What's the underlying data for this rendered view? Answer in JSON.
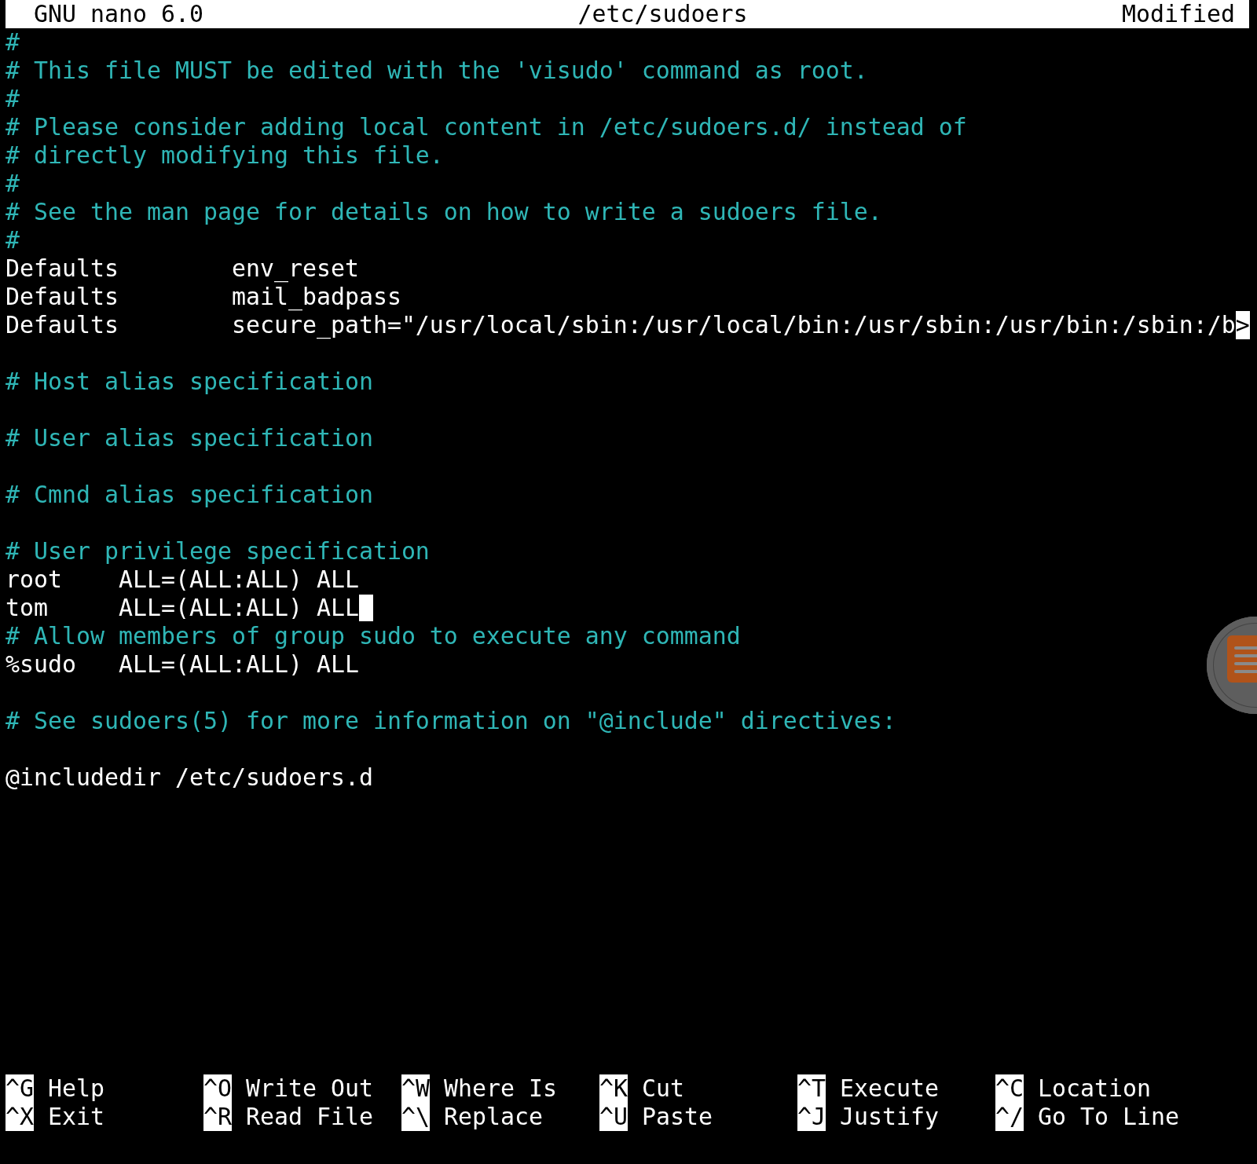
{
  "title_bar": {
    "version": "GNU nano 6.0",
    "filename": "/etc/sudoers",
    "status": "Modified"
  },
  "lines": [
    {
      "kind": "comment",
      "text": "#"
    },
    {
      "kind": "comment",
      "text": "# This file MUST be edited with the 'visudo' command as root."
    },
    {
      "kind": "comment",
      "text": "#"
    },
    {
      "kind": "comment",
      "text": "# Please consider adding local content in /etc/sudoers.d/ instead of"
    },
    {
      "kind": "comment",
      "text": "# directly modifying this file."
    },
    {
      "kind": "comment",
      "text": "#"
    },
    {
      "kind": "comment",
      "text": "# See the man page for details on how to write a sudoers file."
    },
    {
      "kind": "comment",
      "text": "#"
    },
    {
      "kind": "code",
      "text": "Defaults        env_reset"
    },
    {
      "kind": "code",
      "text": "Defaults        mail_badpass"
    },
    {
      "kind": "code",
      "text": "Defaults        secure_path=\"/usr/local/sbin:/usr/local/bin:/usr/sbin:/usr/bin:/sbin:/b",
      "overflow_marker": ">"
    },
    {
      "kind": "blank"
    },
    {
      "kind": "comment",
      "text": "# Host alias specification"
    },
    {
      "kind": "blank"
    },
    {
      "kind": "comment",
      "text": "# User alias specification"
    },
    {
      "kind": "blank"
    },
    {
      "kind": "comment",
      "text": "# Cmnd alias specification"
    },
    {
      "kind": "blank"
    },
    {
      "kind": "comment",
      "text": "# User privilege specification"
    },
    {
      "kind": "code",
      "text": "root    ALL=(ALL:ALL) ALL"
    },
    {
      "kind": "code",
      "text": "tom     ALL=(ALL:ALL) ALL",
      "cursor": true
    },
    {
      "kind": "comment",
      "text": "# Allow members of group sudo to execute any command"
    },
    {
      "kind": "code",
      "text": "%sudo   ALL=(ALL:ALL) ALL"
    },
    {
      "kind": "blank"
    },
    {
      "kind": "comment",
      "text": "# See sudoers(5) for more information on \"@include\" directives:"
    },
    {
      "kind": "blank"
    },
    {
      "kind": "code",
      "text": "@includedir /etc/sudoers.d"
    }
  ],
  "shortcuts": [
    {
      "key": "^G",
      "label": "Help"
    },
    {
      "key": "^X",
      "label": "Exit"
    },
    {
      "key": "^O",
      "label": "Write Out"
    },
    {
      "key": "^R",
      "label": "Read File"
    },
    {
      "key": "^W",
      "label": "Where Is"
    },
    {
      "key": "^\\",
      "label": "Replace"
    },
    {
      "key": "^K",
      "label": "Cut"
    },
    {
      "key": "^U",
      "label": "Paste"
    },
    {
      "key": "^T",
      "label": "Execute"
    },
    {
      "key": "^J",
      "label": "Justify"
    },
    {
      "key": "^C",
      "label": "Location"
    },
    {
      "key": "^/",
      "label": "Go To Line"
    }
  ]
}
